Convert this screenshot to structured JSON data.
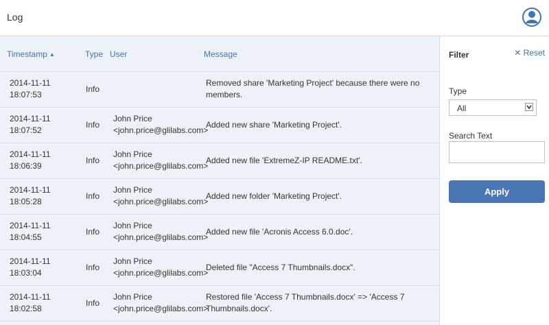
{
  "header": {
    "title": "Log",
    "user_icon": "user-avatar-icon"
  },
  "table": {
    "columns": {
      "timestamp": "Timestamp",
      "type": "Type",
      "user": "User",
      "message": "Message"
    },
    "sort_indicator": "▲",
    "rows": [
      {
        "date": "2014-11-11",
        "time": "18:07:53",
        "type": "Info",
        "user_name": "",
        "user_email": "",
        "msg1": "Removed share 'Marketing Project' because there were no",
        "msg2": "members."
      },
      {
        "date": "2014-11-11",
        "time": "18:07:52",
        "type": "Info",
        "user_name": "John Price",
        "user_email": "<john.price@glilabs.com>",
        "msg1": "Added new share 'Marketing Project'.",
        "msg2": ""
      },
      {
        "date": "2014-11-11",
        "time": "18:06:39",
        "type": "Info",
        "user_name": "John Price",
        "user_email": "<john.price@glilabs.com>",
        "msg1": "Added new file 'ExtremeZ-IP README.txt'.",
        "msg2": ""
      },
      {
        "date": "2014-11-11",
        "time": "18:05:28",
        "type": "Info",
        "user_name": "John Price",
        "user_email": "<john.price@glilabs.com>",
        "msg1": "Added new folder 'Marketing Project'.",
        "msg2": ""
      },
      {
        "date": "2014-11-11",
        "time": "18:04:55",
        "type": "Info",
        "user_name": "John Price",
        "user_email": "<john.price@glilabs.com>",
        "msg1": "Added new file 'Acronis Access 6.0.doc'.",
        "msg2": ""
      },
      {
        "date": "2014-11-11",
        "time": "18:03:04",
        "type": "Info",
        "user_name": "John Price",
        "user_email": "<john.price@glilabs.com>",
        "msg1": "Deleted file \"Access 7 Thumbnails.docx\".",
        "msg2": ""
      },
      {
        "date": "2014-11-11",
        "time": "18:02:58",
        "type": "Info",
        "user_name": "John Price",
        "user_email": "<john.price@glilabs.com>",
        "msg1": "Restored file 'Access 7 Thumbnails.docx' => 'Access 7",
        "msg2": "Thumbnails.docx'."
      }
    ]
  },
  "filter": {
    "title": "Filter",
    "reset_label": "Reset",
    "type_label": "Type",
    "type_value": "All",
    "search_label": "Search Text",
    "search_value": "",
    "apply_label": "Apply"
  },
  "colors": {
    "accent": "#4a76b5",
    "link": "#3f74b4",
    "table_bg": "#edf2f8"
  }
}
